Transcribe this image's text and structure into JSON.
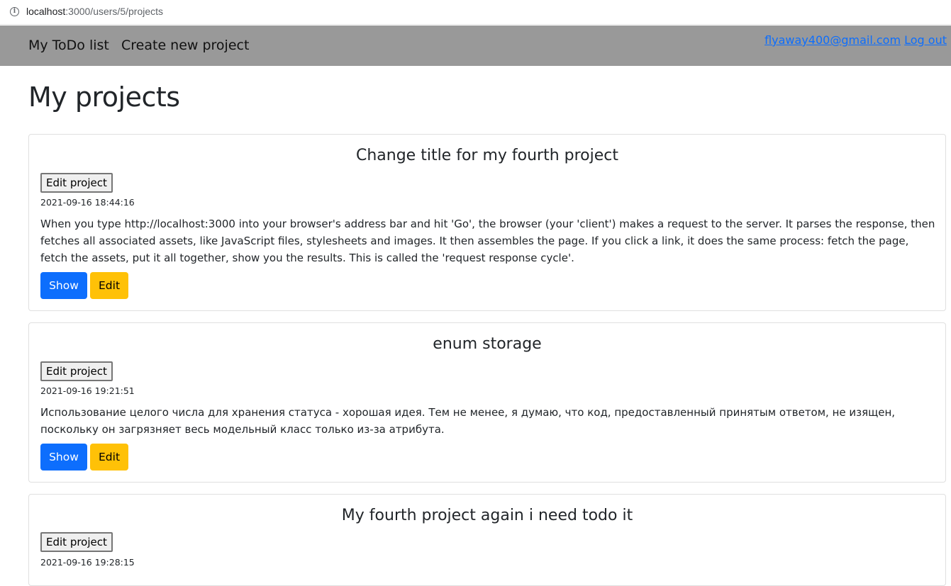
{
  "browser": {
    "url_host": "localhost",
    "url_rest": ":3000/users/5/projects"
  },
  "navbar": {
    "brand": "My ToDo list",
    "create_link": "Create new project",
    "user_email": "flyaway400@gmail.com",
    "logout": "Log out"
  },
  "page": {
    "title": "My projects"
  },
  "projects": [
    {
      "title": "Change title for my fourth project",
      "edit_project_label": "Edit project",
      "date": "2021-09-16 18:44:16",
      "description": "When you type http://localhost:3000 into your browser's address bar and hit 'Go', the browser (your 'client') makes a request to the server. It parses the response, then fetches all associated assets, like JavaScript files, stylesheets and images. It then assembles the page. If you click a link, it does the same process: fetch the page, fetch the assets, put it all together, show you the results. This is called the 'request response cycle'.",
      "show_label": "Show",
      "edit_label": "Edit",
      "accent_show": "#0d6efd",
      "accent_edit": "#ffc107"
    },
    {
      "title": "enum storage",
      "edit_project_label": "Edit project",
      "date": "2021-09-16 19:21:51",
      "description": "Использование целого числа для хранения статуса - хорошая идея. Тем не менее, я думаю, что код, предоставленный принятым ответом, не изящен, поскольку он загрязняет весь модельный класс только из-за атрибута.",
      "show_label": "Show",
      "edit_label": "Edit"
    },
    {
      "title": "My fourth project again i need todo it",
      "edit_project_label": "Edit project",
      "date": "2021-09-16 19:28:15"
    }
  ]
}
